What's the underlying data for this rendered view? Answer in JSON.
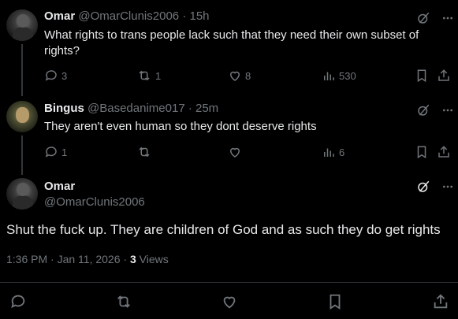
{
  "tweets": [
    {
      "name": "Omar",
      "handle": "@OmarClunis2006",
      "time": "15h",
      "text": "What rights to trans people lack such that they need their own subset of rights?",
      "replies": "3",
      "reposts": "1",
      "likes": "8",
      "views": "530"
    },
    {
      "name": "Bingus",
      "handle": "@Basedanime017",
      "time": "25m",
      "text": "They aren't even human so they dont deserve rights",
      "replies": "1",
      "reposts": "",
      "likes": "",
      "views": "6"
    }
  ],
  "main": {
    "name": "Omar",
    "handle": "@OmarClunis2006",
    "text": "Shut the fuck up. They are children of God and as such they do get rights",
    "timestamp": "1:36 PM · Jan 11, 2026 · ",
    "views_count": "3",
    "views_label": " Views"
  },
  "colors": {
    "background": "#000000",
    "text": "#e7e9ea",
    "muted": "#71767b",
    "divider": "#2f3336"
  }
}
